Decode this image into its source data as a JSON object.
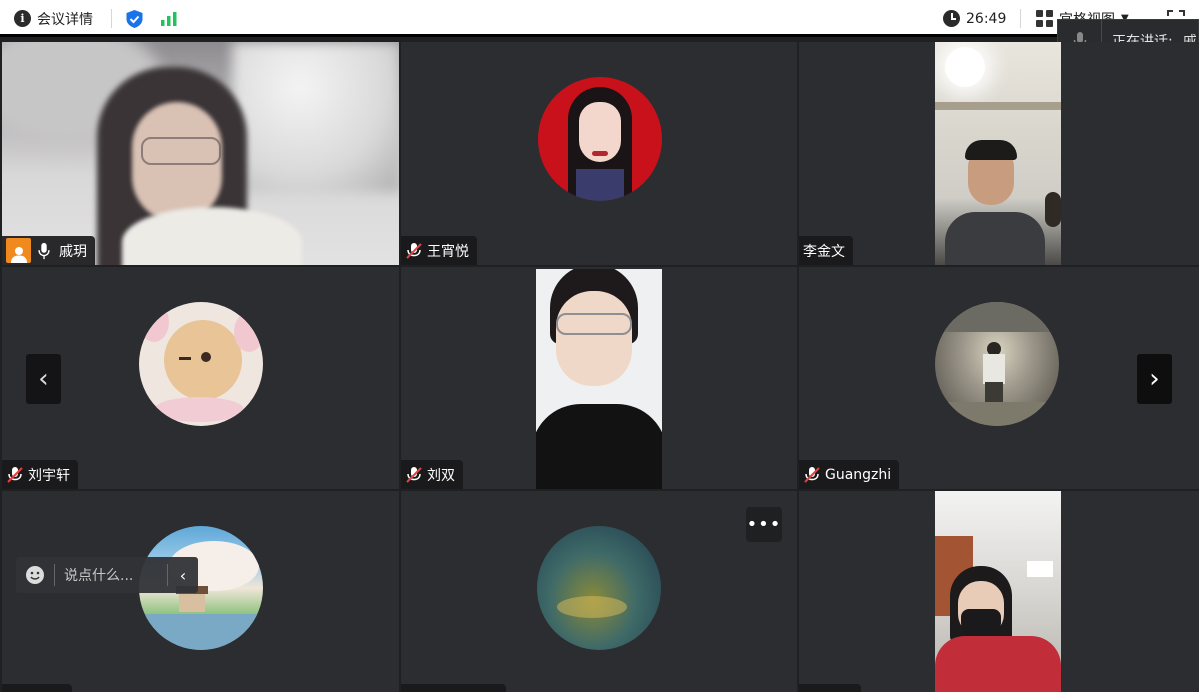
{
  "topbar": {
    "meeting_details_label": "会议详情",
    "timer": "26:49",
    "view_label": "宫格视图"
  },
  "speaking": {
    "label": "正在讲话:",
    "name": "戚"
  },
  "participants": [
    {
      "name": "戚玥",
      "muted": false,
      "host": true
    },
    {
      "name": "王宵悦",
      "muted": true
    },
    {
      "name": "李金文",
      "muted": false
    },
    {
      "name": "刘宇轩",
      "muted": true
    },
    {
      "name": "刘双",
      "muted": true
    },
    {
      "name": "Guangzhi",
      "muted": true
    }
  ],
  "chat": {
    "placeholder": "说点什么..."
  },
  "colors": {
    "active_speaker_border": "#22c35d",
    "host_badge": "#f08a1e",
    "shield": "#1a73e8",
    "signal": "#22c35d"
  },
  "icons": [
    "info-icon",
    "shield-icon",
    "signal-icon",
    "clock-icon",
    "grid-view-icon",
    "fullscreen-icon",
    "mic-icon",
    "mic-muted-icon",
    "host-icon",
    "chevron-left-icon",
    "chevron-right-icon",
    "emoji-icon",
    "more-icon"
  ]
}
